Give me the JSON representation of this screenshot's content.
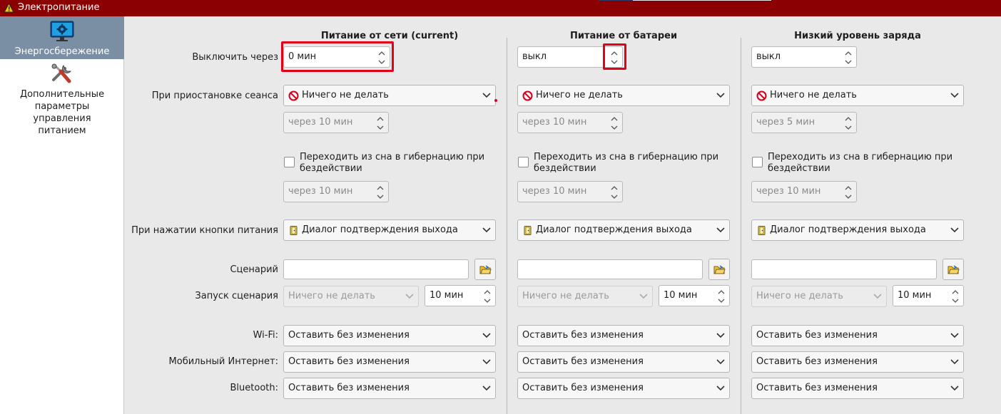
{
  "window": {
    "title": "Электропитание"
  },
  "sidebar": {
    "items": [
      {
        "label": "Энергосбережение",
        "icon": "monitor-gear-icon",
        "active": true
      },
      {
        "label": "Дополнительные параметры управления питанием",
        "icon": "tools-icon",
        "active": false
      }
    ]
  },
  "labels": {
    "shutdown_after": "Выключить через",
    "on_suspend": "При приостановке сеанса",
    "on_power_button": "При нажатии кнопки питания",
    "script": "Сценарий",
    "script_run": "Запуск сценария",
    "wifi": "Wi-Fi:",
    "mobile": "Мобильный Интернет:",
    "bluetooth": "Bluetooth:"
  },
  "columns": [
    {
      "header": "Питание от сети (current)",
      "shutdown_after": "0 мин",
      "suspend_action": "Ничего не делать",
      "suspend_after": "через 10 мин",
      "hibernate_label": "Переходить из сна в гибернацию при бездействии",
      "hibernate_checked": false,
      "hibernate_after": "через 10 мин",
      "power_button_action": "Диалог подтверждения выхода",
      "script_path": "",
      "script_run_action": "Ничего не делать",
      "script_run_after": "10 мин",
      "wifi": "Оставить без изменения",
      "mobile": "Оставить без изменения",
      "bluetooth": "Оставить без изменения"
    },
    {
      "header": "Питание от батареи",
      "shutdown_after": "выкл",
      "suspend_action": "Ничего не делать",
      "suspend_after": "через 10 мин",
      "hibernate_label": "Переходить из сна в гибернацию при бездействии",
      "hibernate_checked": false,
      "hibernate_after": "через 10 мин",
      "power_button_action": "Диалог подтверждения выхода",
      "script_path": "",
      "script_run_action": "Ничего не делать",
      "script_run_after": "10 мин",
      "wifi": "Оставить без изменения",
      "mobile": "Оставить без изменения",
      "bluetooth": "Оставить без изменения"
    },
    {
      "header": "Низкий уровень заряда",
      "shutdown_after": "выкл",
      "suspend_action": "Ничего не делать",
      "suspend_after": "через 5 мин",
      "hibernate_label": "Переходить из сна в гибернацию при бездействии",
      "hibernate_checked": false,
      "hibernate_after": "через 10 мин",
      "power_button_action": "Диалог подтверждения выхода",
      "script_path": "",
      "script_run_action": "Ничего не делать",
      "script_run_after": "10 мин",
      "wifi": "Оставить без изменения",
      "mobile": "Оставить без изменения",
      "bluetooth": "Оставить без изменения"
    }
  ],
  "colors": {
    "titlebar": "#8b0000",
    "sidebar_active": "#7b8fa4",
    "highlight": "#e5001a"
  }
}
